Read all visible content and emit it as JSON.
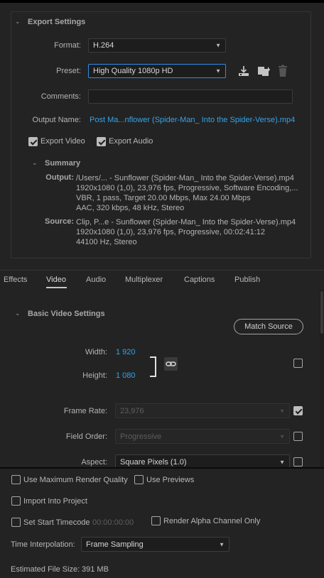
{
  "export_settings": {
    "title": "Export Settings",
    "format_label": "Format:",
    "format_value": "H.264",
    "preset_label": "Preset:",
    "preset_value": "High Quality 1080p HD",
    "comments_label": "Comments:",
    "comments_value": "",
    "output_name_label": "Output Name:",
    "output_name_value": "Post Ma...nflower (Spider-Man_ Into the Spider-Verse).mp4",
    "export_video_label": "Export Video",
    "export_video_checked": true,
    "export_audio_label": "Export Audio",
    "export_audio_checked": true
  },
  "summary": {
    "title": "Summary",
    "output_label": "Output:",
    "output_lines": [
      "/Users/... - Sunflower (Spider-Man_ Into the Spider-Verse).mp4",
      "1920x1080 (1,0), 23,976 fps, Progressive, Software Encoding,...",
      "VBR, 1 pass, Target 20.00 Mbps, Max 24.00 Mbps",
      "AAC, 320 kbps, 48 kHz, Stereo"
    ],
    "source_label": "Source:",
    "source_lines": [
      "Clip, P...e - Sunflower (Spider-Man_ Into the Spider-Verse).mp4",
      "1920x1080 (1,0), 23,976 fps, Progressive, 00:02:41:12",
      "44100 Hz, Stereo"
    ]
  },
  "tabs": [
    {
      "label": "Effects",
      "active": false
    },
    {
      "label": "Video",
      "active": true
    },
    {
      "label": "Audio",
      "active": false
    },
    {
      "label": "Multiplexer",
      "active": false
    },
    {
      "label": "Captions",
      "active": false
    },
    {
      "label": "Publish",
      "active": false
    }
  ],
  "basic_video": {
    "title": "Basic Video Settings",
    "match_source_label": "Match Source",
    "width_label": "Width:",
    "width_value": "1 920",
    "height_label": "Height:",
    "height_value": "1 080",
    "frame_rate_label": "Frame Rate:",
    "frame_rate_value": "23,976",
    "frame_rate_checked": true,
    "field_order_label": "Field Order:",
    "field_order_value": "Progressive",
    "field_order_checked": false,
    "aspect_label": "Aspect:",
    "aspect_value": "Square Pixels (1.0)",
    "aspect_checked": false,
    "dimension_checked": false
  },
  "bottom": {
    "max_render_label": "Use Maximum Render Quality",
    "use_previews_label": "Use Previews",
    "import_project_label": "Import Into Project",
    "set_start_tc_label": "Set Start Timecode",
    "start_tc_value": "00:00:00:00",
    "render_alpha_label": "Render Alpha Channel Only",
    "time_interp_label": "Time Interpolation:",
    "time_interp_value": "Frame Sampling",
    "file_size_label": "Estimated File Size:",
    "file_size_value": "391 MB"
  },
  "icons": [
    "chevron-down-icon",
    "save-preset-icon",
    "import-preset-icon",
    "delete-preset-icon",
    "link-icon"
  ],
  "colors": {
    "accent_blue": "#35a3ea",
    "background": "#232323",
    "focus_border": "#2d8ceb"
  }
}
